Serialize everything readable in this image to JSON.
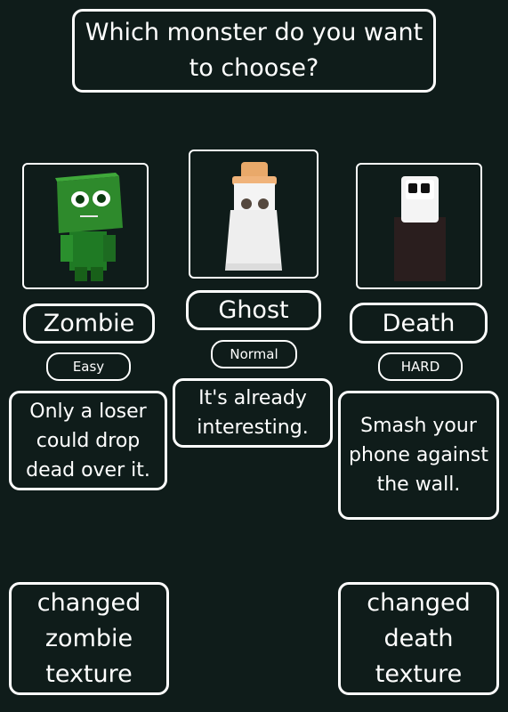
{
  "header": {
    "title": "Which monster do you want to choose?"
  },
  "monsters": [
    {
      "name": "Zombie",
      "difficulty": "Easy",
      "description": "Only a loser could drop dead over it.",
      "accent": "#2e8a2c"
    },
    {
      "name": "Ghost",
      "difficulty": "Normal",
      "description": "It's already interesting.",
      "accent": "#e9a96a"
    },
    {
      "name": "Death",
      "difficulty": "HARD",
      "description": "Smash your phone against the wall.",
      "accent": "#2a1e1e"
    }
  ],
  "notes": {
    "left": "changed zombie texture",
    "right": "changed death texture"
  },
  "colors": {
    "background": "#0f1c1a",
    "border": "#ffffff",
    "text": "#ffffff"
  }
}
